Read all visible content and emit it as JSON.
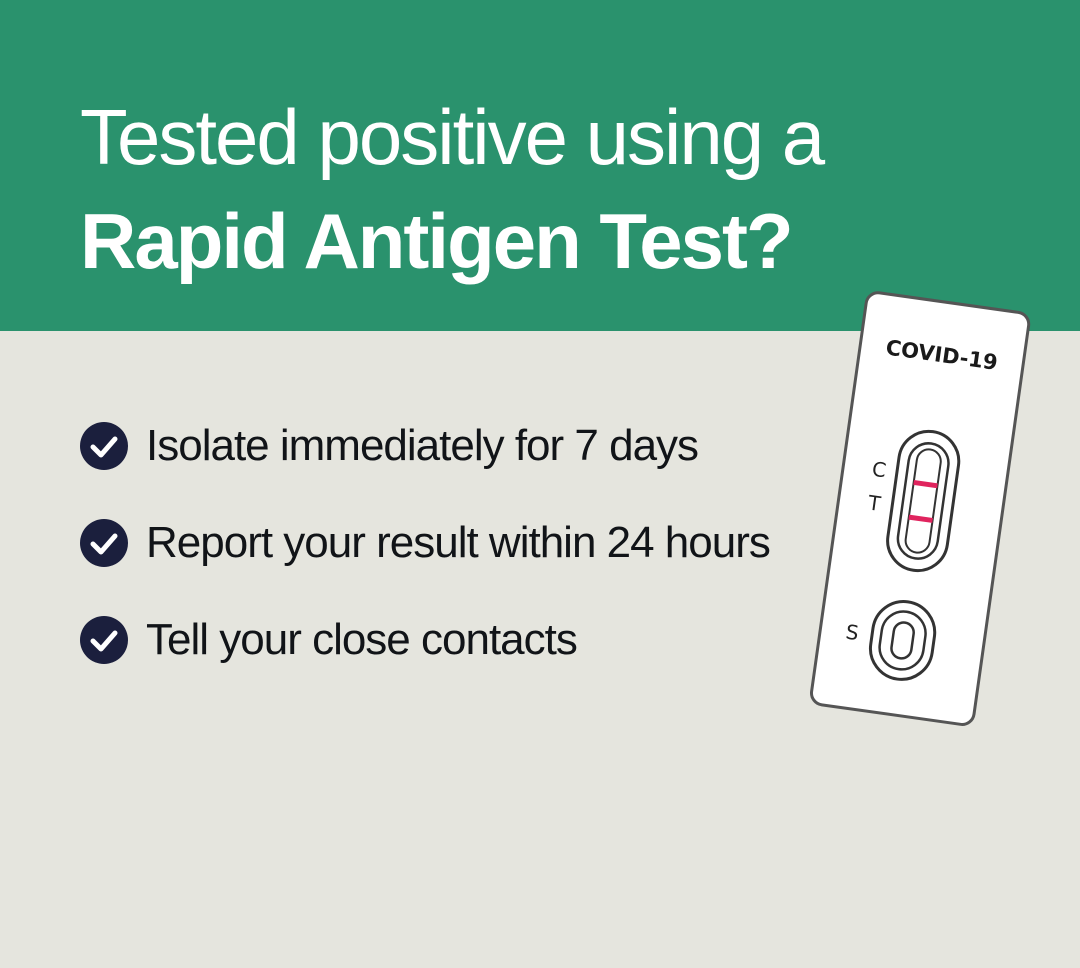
{
  "header": {
    "title_line_1": "Tested  positive using a",
    "title_line_2": "Rapid Antigen Test?",
    "background_color": "#2a926d"
  },
  "checklist": {
    "icon": "check-circle-icon",
    "icon_color": "#1b1f3d",
    "items": [
      {
        "label": "Isolate immediately for 7 days"
      },
      {
        "label": "Report your result within 24 hours"
      },
      {
        "label": "Tell your close contacts"
      }
    ]
  },
  "test_device": {
    "brand_label": "COVID-19",
    "control_label": "C",
    "test_label": "T",
    "sample_label": "S",
    "line_color": "#e0245e"
  },
  "page": {
    "background_color": "#e5e5de"
  }
}
